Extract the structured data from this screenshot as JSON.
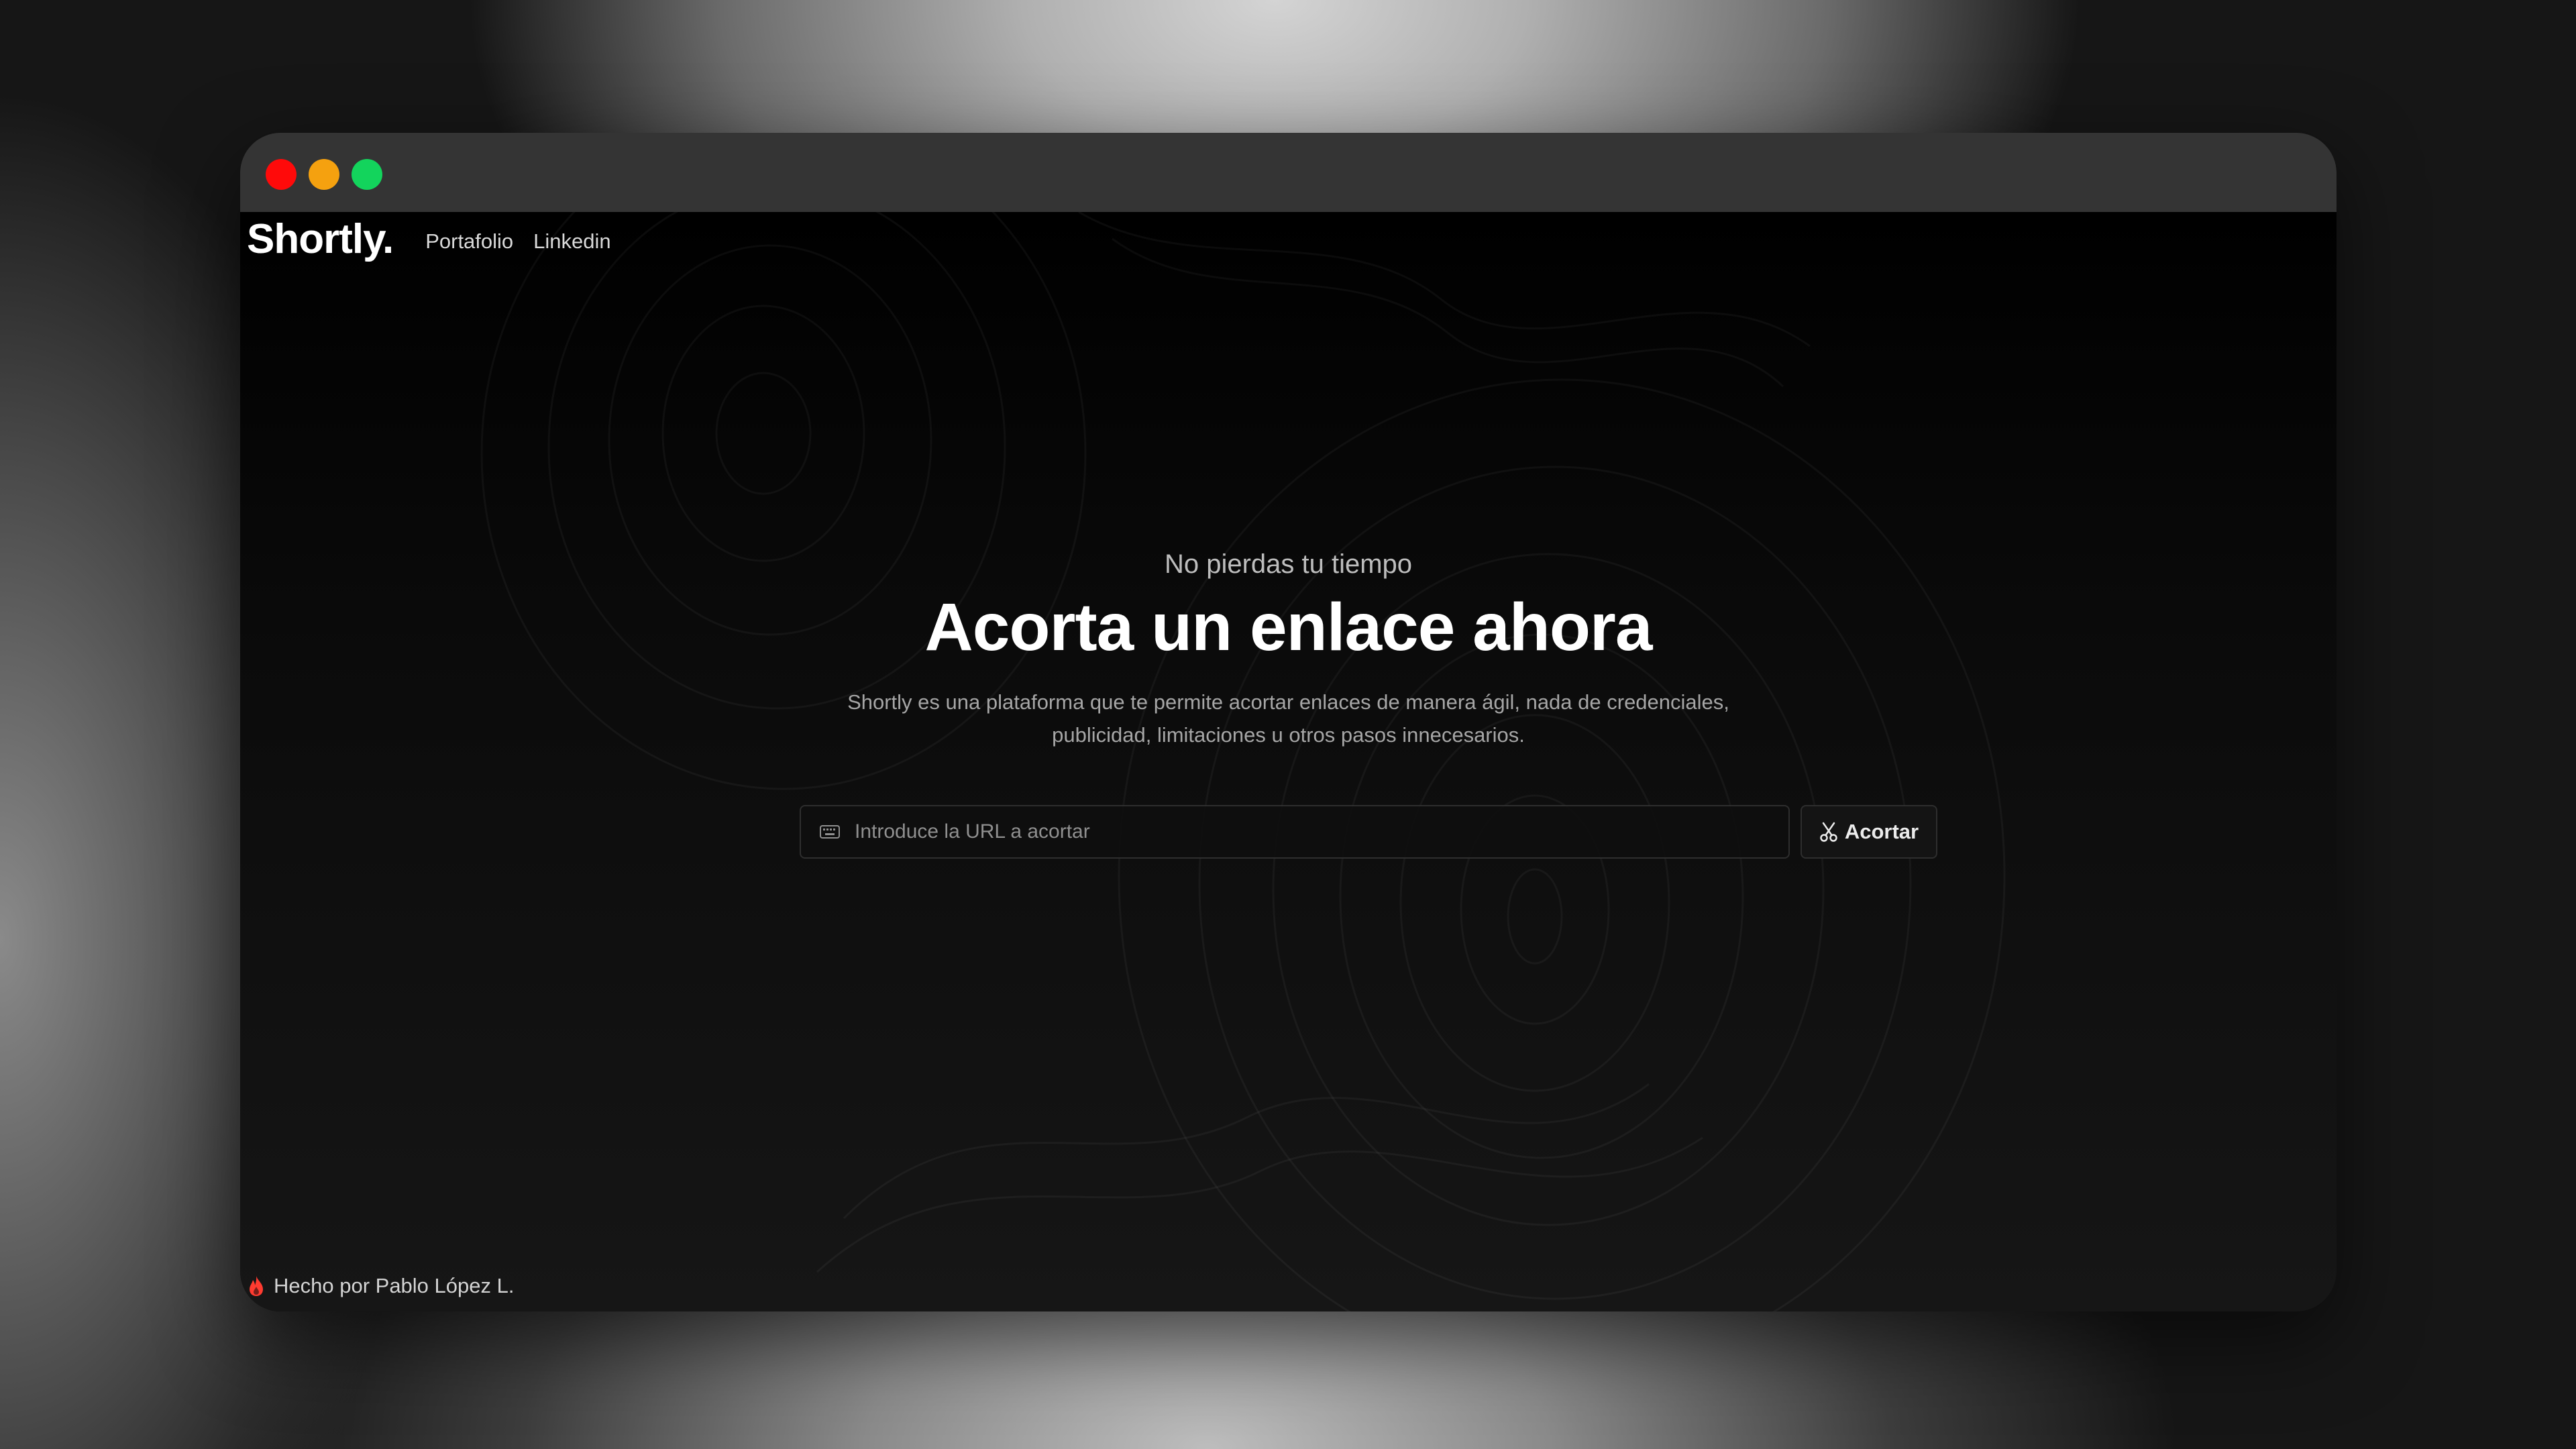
{
  "nav": {
    "brand": "Shortly.",
    "links": [
      {
        "label": "Portafolio"
      },
      {
        "label": "Linkedin"
      }
    ]
  },
  "hero": {
    "eyebrow": "No pierdas tu tiempo",
    "headline": "Acorta un enlace ahora",
    "description": "Shortly es una plataforma que te permite acortar enlaces de manera ágil, nada de credenciales, publicidad, limitaciones u otros pasos innecesarios."
  },
  "form": {
    "input_icon": "keyboard-icon",
    "placeholder": "Introduce la URL a acortar",
    "value": "",
    "button_icon": "scissors-icon",
    "button_label": "Acortar"
  },
  "footer": {
    "icon": "fire-icon",
    "text": "Hecho por Pablo López L."
  },
  "colors": {
    "traffic_red": "#ff0a0a",
    "traffic_yellow": "#f5a10f",
    "traffic_green": "#13d45c",
    "titlebar": "#343434",
    "fire": "#ff3b30"
  }
}
